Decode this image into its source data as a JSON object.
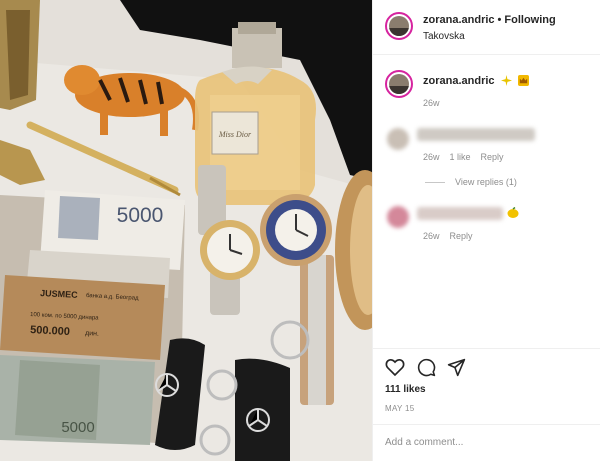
{
  "header": {
    "username": "zorana.andric",
    "separator": "•",
    "follow_label": "Following",
    "location": "Takovska"
  },
  "caption": {
    "username": "zorana.andric",
    "emojis": [
      "sparkle-emoji",
      "crown-emoji"
    ],
    "time": "26w"
  },
  "comments": [
    {
      "time": "26w",
      "likes": "1 like",
      "reply_label": "Reply",
      "view_replies": "View replies (1)"
    },
    {
      "time": "26w",
      "reply_label": "Reply",
      "emoji": "lemon-emoji"
    }
  ],
  "actions": {
    "icons": [
      "heart-icon",
      "comment-icon",
      "share-icon"
    ]
  },
  "likes": "111 likes",
  "date": "MAY 15",
  "comment_input": {
    "placeholder": "Add a comment..."
  },
  "photo": {
    "banknote_value": "5000",
    "bank_band": {
      "brand": "JUSMEC",
      "bank_line": "банка а.д. Београд",
      "count_line": "100 ком. по 5000 динара",
      "amount": "500.000",
      "unit": "дин."
    },
    "perfume_label": "Miss Dior"
  },
  "colors": {
    "story_ring": "#d6249f",
    "text": "#262626",
    "muted": "#8e8e8e",
    "divider": "#efefef"
  }
}
